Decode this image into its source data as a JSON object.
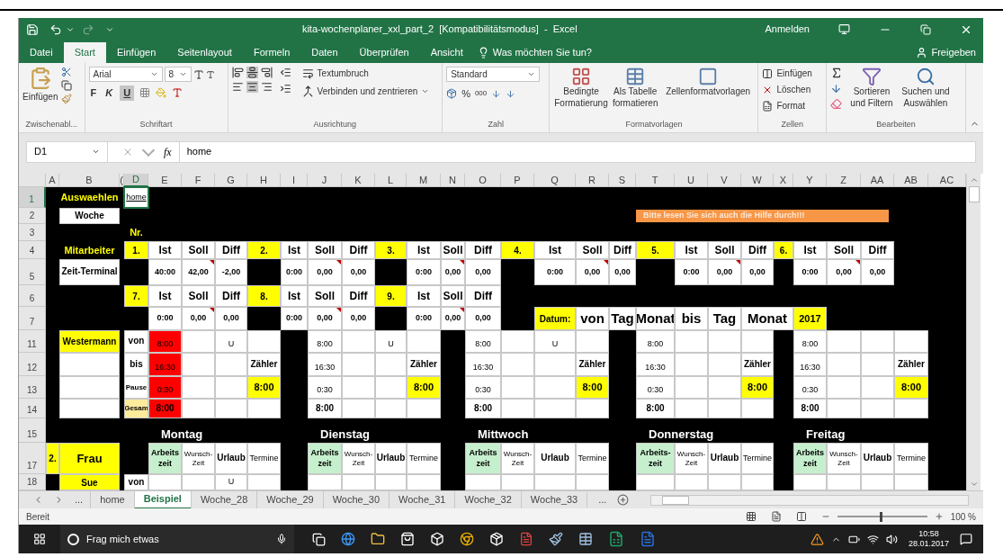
{
  "window": {
    "title": "kita-wochenplaner_xxl_part_2  [Kompatibilitätsmodus]  -  Excel",
    "account": "Anmelden"
  },
  "menu_tabs": [
    {
      "label": "Datei",
      "selected": false
    },
    {
      "label": "Start",
      "selected": true
    },
    {
      "label": "Einfügen",
      "selected": false
    },
    {
      "label": "Seitenlayout",
      "selected": false
    },
    {
      "label": "Formeln",
      "selected": false
    },
    {
      "label": "Daten",
      "selected": false
    },
    {
      "label": "Überprüfen",
      "selected": false
    },
    {
      "label": "Ansicht",
      "selected": false
    }
  ],
  "tell_me": "Was möchten Sie tun?",
  "share": "Freigeben",
  "ribbon": {
    "clipboard": {
      "label": "Zwischenabl...",
      "paste": "Einfügen"
    },
    "font": {
      "label": "Schriftart",
      "family": "Arial",
      "size": "8",
      "bold": "F",
      "italic": "K",
      "underline": {
        "label": "U",
        "on": true
      }
    },
    "alignment": {
      "label": "Ausrichtung",
      "middle_on": true,
      "center_on": true,
      "wrap": "Textumbruch",
      "merge": "Verbinden und zentrieren"
    },
    "number": {
      "label": "Zahl",
      "format": "Standard",
      "percent": "%",
      "thousands": "000"
    },
    "styles": {
      "label": "Formatvorlagen",
      "conditional": "Bedingte Formatierung",
      "table": "Als Tabelle formatieren",
      "cell_styles": "Zellenformatvorlagen"
    },
    "cells": {
      "label": "Zellen",
      "insert": "Einfügen",
      "delete": "Löschen",
      "format": "Format"
    },
    "editing": {
      "label": "Bearbeiten",
      "sort": "Sortieren und Filtern",
      "find": "Suchen und Auswählen"
    }
  },
  "formula_bar": {
    "name_box": "D1",
    "fx": "fx",
    "value": "home"
  },
  "sheet": {
    "columns": [
      {
        "label": "A",
        "selected": false
      },
      {
        "label": "B",
        "selected": false
      },
      {
        "label": "(",
        "selected": false
      },
      {
        "label": "D",
        "selected": true
      },
      {
        "label": "E",
        "selected": false
      },
      {
        "label": "F",
        "selected": false
      },
      {
        "label": "G",
        "selected": false
      },
      {
        "label": "H",
        "selected": false
      },
      {
        "label": "I",
        "selected": false
      },
      {
        "label": "J",
        "selected": false
      },
      {
        "label": "K",
        "selected": false
      },
      {
        "label": "L",
        "selected": false
      },
      {
        "label": "M",
        "selected": false
      },
      {
        "label": "N",
        "selected": false
      },
      {
        "label": "O",
        "selected": false
      },
      {
        "label": "P",
        "selected": false
      },
      {
        "label": "Q",
        "selected": false
      },
      {
        "label": "R",
        "selected": false
      },
      {
        "label": "S",
        "selected": false
      },
      {
        "label": "T",
        "selected": false
      },
      {
        "label": "U",
        "selected": false
      },
      {
        "label": "V",
        "selected": false
      },
      {
        "label": "W",
        "selected": false
      },
      {
        "label": "X",
        "selected": false
      },
      {
        "label": "Y",
        "selected": false
      },
      {
        "label": "Z",
        "selected": false
      },
      {
        "label": "AA",
        "selected": false
      },
      {
        "label": "AB",
        "selected": false
      },
      {
        "label": "AC",
        "selected": false
      }
    ],
    "rows": [
      {
        "label": "1",
        "selected": true,
        "cells": [
          null,
          {
            "text": "Auswaehlen",
            "kind": "title"
          },
          null,
          {
            "text": "home",
            "kind": "link",
            "color": "#ffffff"
          }
        ]
      },
      {
        "label": "2",
        "selected": false,
        "cells": [
          null,
          {
            "text": "Woche",
            "kind": "bold",
            "color": "#ffffff"
          },
          null,
          null,
          null,
          null,
          null,
          null,
          null,
          null,
          null,
          null,
          null,
          null,
          null,
          null,
          null,
          null,
          null,
          {
            "text": "Bitte lesen Sie sich auch die Hilfe durch!!!",
            "kind": "banner",
            "color": "#f79646"
          }
        ]
      },
      {
        "label": "3",
        "selected": false,
        "cells": [
          null,
          null,
          null,
          {
            "text": "Nr.",
            "kind": "title"
          }
        ]
      },
      {
        "label": "4",
        "selected": false,
        "cells": [
          null,
          {
            "text": "Mitarbeiter",
            "kind": "title"
          },
          null,
          {
            "text": "1.",
            "kind": "marker",
            "color": "#ffff00"
          },
          {
            "text": "Ist",
            "kind": "head",
            "color": "#ffffff"
          },
          {
            "text": "Soll",
            "kind": "head",
            "color": "#ffffff"
          },
          {
            "text": "Diff",
            "kind": "head",
            "color": "#ffffff"
          },
          {
            "text": "2.",
            "kind": "marker",
            "color": "#ffff00"
          },
          {
            "text": "Ist",
            "kind": "head",
            "color": "#ffffff"
          },
          {
            "text": "Soll",
            "kind": "head",
            "color": "#ffffff"
          },
          {
            "text": "Diff",
            "kind": "head",
            "color": "#ffffff"
          },
          {
            "text": "3.",
            "kind": "marker",
            "color": "#ffff00"
          },
          {
            "text": "Ist",
            "kind": "head",
            "color": "#ffffff"
          },
          {
            "text": "Soll",
            "kind": "head",
            "color": "#ffffff"
          },
          {
            "text": "Diff",
            "kind": "head",
            "color": "#ffffff"
          },
          {
            "text": "4.",
            "kind": "marker",
            "color": "#ffff00"
          },
          {
            "text": "Ist",
            "kind": "head",
            "color": "#ffffff"
          },
          {
            "text": "Soll",
            "kind": "head",
            "color": "#ffffff"
          },
          {
            "text": "Diff",
            "kind": "head",
            "color": "#ffffff"
          },
          {
            "text": "5.",
            "kind": "marker",
            "color": "#ffff00"
          },
          {
            "text": "Ist",
            "kind": "head",
            "color": "#ffffff"
          },
          {
            "text": "Soll",
            "kind": "head",
            "color": "#ffffff"
          },
          {
            "text": "Diff",
            "kind": "head",
            "color": "#ffffff"
          },
          {
            "text": "6.",
            "kind": "marker",
            "color": "#ffff00"
          },
          {
            "text": "Ist",
            "kind": "head",
            "color": "#ffffff"
          },
          {
            "text": "Soll",
            "kind": "head",
            "color": "#ffffff"
          },
          {
            "text": "Diff",
            "kind": "head",
            "color": "#ffffff"
          }
        ]
      },
      {
        "label": "5",
        "selected": false,
        "cells": [
          null,
          {
            "text": "Zeit-Terminal",
            "kind": "bold",
            "color": "#ffffff"
          },
          null,
          null,
          {
            "text": "40:00",
            "kind": "value",
            "color": "#ffffff"
          },
          {
            "text": "42,00",
            "kind": "note",
            "color": "#ffffff"
          },
          {
            "text": "-2,00",
            "kind": "value",
            "color": "#ffffff"
          },
          null,
          {
            "text": "0:00",
            "kind": "value",
            "color": "#ffffff"
          },
          {
            "text": "0,00",
            "kind": "note",
            "color": "#ffffff"
          },
          {
            "text": "0,00",
            "kind": "value",
            "color": "#ffffff"
          },
          null,
          {
            "text": "0:00",
            "kind": "value",
            "color": "#ffffff"
          },
          {
            "text": "0,00",
            "kind": "note",
            "color": "#ffffff"
          },
          {
            "text": "0,00",
            "kind": "value",
            "color": "#ffffff"
          },
          null,
          {
            "text": "0:00",
            "kind": "value",
            "color": "#ffffff"
          },
          {
            "text": "0,00",
            "kind": "note",
            "color": "#ffffff"
          },
          {
            "text": "0,00",
            "kind": "value",
            "color": "#ffffff"
          },
          null,
          {
            "text": "0:00",
            "kind": "value",
            "color": "#ffffff"
          },
          {
            "text": "0,00",
            "kind": "note",
            "color": "#ffffff"
          },
          {
            "text": "0,00",
            "kind": "value",
            "color": "#ffffff"
          },
          null,
          {
            "text": "0:00",
            "kind": "value",
            "color": "#ffffff"
          },
          {
            "text": "0,00",
            "kind": "note",
            "color": "#ffffff"
          },
          {
            "text": "0,00",
            "kind": "value",
            "color": "#ffffff"
          }
        ]
      },
      {
        "label": "6",
        "selected": false,
        "cells": [
          null,
          null,
          null,
          {
            "text": "7.",
            "kind": "marker",
            "color": "#ffff00"
          },
          {
            "text": "Ist",
            "kind": "head",
            "color": "#ffffff"
          },
          {
            "text": "Soll",
            "kind": "head",
            "color": "#ffffff"
          },
          {
            "text": "Diff",
            "kind": "head",
            "color": "#ffffff"
          },
          {
            "text": "8.",
            "kind": "marker",
            "color": "#ffff00"
          },
          {
            "text": "Ist",
            "kind": "head",
            "color": "#ffffff"
          },
          {
            "text": "Soll",
            "kind": "head",
            "color": "#ffffff"
          },
          {
            "text": "Diff",
            "kind": "head",
            "color": "#ffffff"
          },
          {
            "text": "9.",
            "kind": "marker",
            "color": "#ffff00"
          },
          {
            "text": "Ist",
            "kind": "head",
            "color": "#ffffff"
          },
          {
            "text": "Soll",
            "kind": "head",
            "color": "#ffffff"
          },
          {
            "text": "Diff",
            "kind": "head",
            "color": "#ffffff"
          }
        ]
      },
      {
        "label": "7",
        "selected": false,
        "cells": [
          null,
          null,
          null,
          null,
          {
            "text": "0:00",
            "kind": "value",
            "color": "#ffffff"
          },
          {
            "text": "0,00",
            "kind": "note",
            "color": "#ffffff"
          },
          {
            "text": "0,00",
            "kind": "value",
            "color": "#ffffff"
          },
          null,
          {
            "text": "0:00",
            "kind": "value",
            "color": "#ffffff"
          },
          {
            "text": "0,00",
            "kind": "note",
            "color": "#ffffff"
          },
          {
            "text": "0,00",
            "kind": "value",
            "color": "#ffffff"
          },
          null,
          {
            "text": "0:00",
            "kind": "value",
            "color": "#ffffff"
          },
          {
            "text": "0,00",
            "kind": "note",
            "color": "#ffffff"
          },
          {
            "text": "0,00",
            "kind": "value",
            "color": "#ffffff"
          },
          null,
          {
            "text": "Datum:",
            "kind": "marker",
            "color": "#ffff00"
          },
          {
            "text": "von",
            "kind": "big",
            "color": "#ffffff"
          },
          {
            "text": "Tag",
            "kind": "big",
            "color": "#ffffff"
          },
          {
            "text": "Monat",
            "kind": "big",
            "color": "#ffffff"
          },
          {
            "text": "bis",
            "kind": "big",
            "color": "#ffffff"
          },
          {
            "text": "Tag",
            "kind": "big",
            "color": "#ffffff"
          },
          {
            "text": "Monat",
            "kind": "big-wide",
            "color": "#ffffff"
          },
          null,
          {
            "text": "2017",
            "kind": "year",
            "color": "#ffff00"
          }
        ]
      },
      {
        "label": "11",
        "selected": false,
        "cells": [
          null,
          {
            "text": "Westermann",
            "kind": "marker",
            "color": "#ffff00"
          },
          null,
          {
            "text": "von",
            "kind": "bold",
            "color": "#ffffff"
          },
          {
            "text": "8:00",
            "kind": "time",
            "color": "#ff0000"
          },
          {
            "color": "#ffffff"
          },
          {
            "text": "U",
            "kind": "time",
            "color": "#ffffff"
          },
          {
            "color": "#ffffff"
          },
          null,
          {
            "text": "8:00",
            "kind": "time",
            "color": "#ffffff"
          },
          {
            "color": "#ffffff"
          },
          {
            "text": "U",
            "kind": "time",
            "color": "#ffffff"
          },
          {
            "color": "#ffffff"
          },
          null,
          {
            "text": "8:00",
            "kind": "time",
            "color": "#ffffff"
          },
          {
            "color": "#ffffff"
          },
          {
            "text": "U",
            "kind": "time",
            "color": "#ffffff"
          },
          {
            "color": "#ffffff"
          },
          null,
          {
            "text": "8:00",
            "kind": "time",
            "color": "#ffffff"
          },
          {
            "color": "#ffffff"
          },
          {
            "color": "#ffffff"
          },
          {
            "color": "#ffffff"
          },
          null,
          {
            "text": "8:00",
            "kind": "time",
            "color": "#ffffff"
          },
          {
            "color": "#ffffff"
          },
          {
            "color": "#ffffff"
          },
          {
            "color": "#ffffff"
          }
        ]
      },
      {
        "label": "12",
        "selected": false,
        "cells": [
          null,
          {
            "color": "#ffffff"
          },
          null,
          {
            "text": "bis",
            "kind": "bold",
            "color": "#ffffff"
          },
          {
            "text": "16:30",
            "kind": "time",
            "color": "#ff0000"
          },
          {
            "color": "#ffffff"
          },
          {
            "color": "#ffffff"
          },
          {
            "text": "Zähler",
            "kind": "bold",
            "color": "#ffffff"
          },
          null,
          {
            "text": "16:30",
            "kind": "time",
            "color": "#ffffff"
          },
          {
            "color": "#ffffff"
          },
          {
            "color": "#ffffff"
          },
          {
            "text": "Zähler",
            "kind": "bold",
            "color": "#ffffff"
          },
          null,
          {
            "text": "16:30",
            "kind": "time",
            "color": "#ffffff"
          },
          {
            "color": "#ffffff"
          },
          {
            "color": "#ffffff"
          },
          {
            "text": "Zähler",
            "kind": "bold",
            "color": "#ffffff"
          },
          null,
          {
            "text": "16:30",
            "kind": "time",
            "color": "#ffffff"
          },
          {
            "color": "#ffffff"
          },
          {
            "color": "#ffffff"
          },
          {
            "text": "Zähler",
            "kind": "bold",
            "color": "#ffffff"
          },
          null,
          {
            "text": "16:30",
            "kind": "time",
            "color": "#ffffff"
          },
          {
            "color": "#ffffff"
          },
          {
            "color": "#ffffff"
          },
          {
            "text": "Zähler",
            "kind": "bold",
            "color": "#ffffff"
          }
        ]
      },
      {
        "label": "13",
        "selected": false,
        "cells": [
          null,
          {
            "color": "#ffffff"
          },
          null,
          {
            "text": "Pause",
            "kind": "narrow",
            "color": "#ffffff"
          },
          {
            "text": "0:30",
            "kind": "time",
            "color": "#ff0000"
          },
          {
            "color": "#ffffff"
          },
          {
            "color": "#ffffff"
          },
          {
            "text": "8:00",
            "kind": "total",
            "color": "#ffff00"
          },
          null,
          {
            "text": "0:30",
            "kind": "time",
            "color": "#ffffff"
          },
          {
            "color": "#ffffff"
          },
          {
            "color": "#ffffff"
          },
          {
            "text": "8:00",
            "kind": "total",
            "color": "#ffff00"
          },
          null,
          {
            "text": "0:30",
            "kind": "time",
            "color": "#ffffff"
          },
          {
            "color": "#ffffff"
          },
          {
            "color": "#ffffff"
          },
          {
            "text": "8:00",
            "kind": "total",
            "color": "#ffff00"
          },
          null,
          {
            "text": "0:30",
            "kind": "time",
            "color": "#ffffff"
          },
          {
            "color": "#ffffff"
          },
          {
            "color": "#ffffff"
          },
          {
            "text": "8:00",
            "kind": "total",
            "color": "#ffff00"
          },
          null,
          {
            "text": "0:30",
            "kind": "time",
            "color": "#ffffff"
          },
          {
            "color": "#ffffff"
          },
          {
            "color": "#ffffff"
          },
          {
            "text": "8:00",
            "kind": "total",
            "color": "#ffff00"
          }
        ]
      },
      {
        "label": "14",
        "selected": false,
        "cells": [
          null,
          {
            "color": "#ffffff"
          },
          null,
          {
            "text": "Gesam",
            "kind": "narrow",
            "color": "#ffeb9c"
          },
          {
            "text": "8:00",
            "kind": "bold",
            "color": "#ff0000"
          },
          {
            "color": "#ffffff"
          },
          {
            "color": "#ffffff"
          },
          {
            "color": "#ffffff"
          },
          null,
          {
            "text": "8:00",
            "kind": "bold",
            "color": "#ffffff"
          },
          {
            "color": "#ffffff"
          },
          {
            "color": "#ffffff"
          },
          {
            "color": "#ffffff"
          },
          null,
          {
            "text": "8:00",
            "kind": "bold",
            "color": "#ffffff"
          },
          {
            "color": "#ffffff"
          },
          {
            "color": "#ffffff"
          },
          {
            "color": "#ffffff"
          },
          null,
          {
            "text": "8:00",
            "kind": "bold",
            "color": "#ffffff"
          },
          {
            "color": "#ffffff"
          },
          {
            "color": "#ffffff"
          },
          {
            "color": "#ffffff"
          },
          null,
          {
            "text": "8:00",
            "kind": "bold",
            "color": "#ffffff"
          },
          {
            "color": "#ffffff"
          },
          {
            "color": "#ffffff"
          },
          {
            "color": "#ffffff"
          }
        ]
      },
      {
        "label": "15",
        "selected": false,
        "cells": [
          null,
          null,
          null,
          null,
          {
            "text": "Montag",
            "kind": "day"
          },
          null,
          null,
          null,
          null,
          {
            "text": "Dienstag",
            "kind": "day"
          },
          null,
          null,
          null,
          null,
          {
            "text": "Mittwoch",
            "kind": "day"
          },
          null,
          null,
          null,
          null,
          {
            "text": "Donnerstag",
            "kind": "day"
          },
          null,
          null,
          null,
          null,
          {
            "text": "Freitag",
            "kind": "day"
          }
        ]
      },
      {
        "label": "17",
        "selected": false,
        "cells": [
          {
            "text": "2.",
            "kind": "marker",
            "color": "#ffff00"
          },
          {
            "text": "Frau",
            "kind": "name",
            "color": "#ffff00"
          },
          null,
          null,
          {
            "text": "Arbeits zeit",
            "kind": "colhead",
            "color": "#c6efce"
          },
          {
            "text": "Wunsch-Zeit",
            "kind": "small",
            "color": "#ffffff"
          },
          {
            "text": "Urlaub",
            "kind": "bold",
            "color": "#ffffff"
          },
          {
            "text": "Termine",
            "kind": "plain",
            "color": "#ffffff"
          },
          null,
          {
            "text": "Arbeits zeit",
            "kind": "colhead",
            "color": "#c6efce"
          },
          {
            "text": "Wunsch-Zeit",
            "kind": "small",
            "color": "#ffffff"
          },
          {
            "text": "Urlaub",
            "kind": "bold",
            "color": "#ffffff"
          },
          {
            "text": "Termine",
            "kind": "plain",
            "color": "#ffffff"
          },
          null,
          {
            "text": "Arbeits zeit",
            "kind": "colhead",
            "color": "#c6efce"
          },
          {
            "text": "Wunsch-Zeit",
            "kind": "small",
            "color": "#ffffff"
          },
          {
            "text": "Urlaub",
            "kind": "bold",
            "color": "#ffffff"
          },
          {
            "text": "Termine",
            "kind": "plain",
            "color": "#ffffff"
          },
          null,
          {
            "text": "Arbeits-zeit",
            "kind": "colhead",
            "color": "#c6efce"
          },
          {
            "text": "Wunsch-Zeit",
            "kind": "small",
            "color": "#ffffff"
          },
          {
            "text": "Urlaub",
            "kind": "bold",
            "color": "#ffffff"
          },
          {
            "text": "Termine",
            "kind": "plain",
            "color": "#ffffff"
          },
          null,
          {
            "text": "Arbeits zeit",
            "kind": "colhead",
            "color": "#c6efce"
          },
          {
            "text": "Wunsch-Zeit",
            "kind": "small",
            "color": "#ffffff"
          },
          {
            "text": "Urlaub",
            "kind": "bold",
            "color": "#ffffff"
          },
          {
            "text": "Termine",
            "kind": "plain",
            "color": "#ffffff"
          }
        ]
      },
      {
        "label": "18",
        "selected": false,
        "cells": [
          null,
          {
            "text": "Sue",
            "kind": "marker",
            "color": "#ffff00"
          },
          null,
          {
            "text": "von",
            "kind": "bold",
            "color": "#ffffff"
          },
          {
            "color": "#ffffff"
          },
          {
            "color": "#ffffff"
          },
          {
            "text": "U",
            "kind": "time",
            "color": "#ffffff"
          },
          {
            "color": "#ffffff"
          },
          null,
          {
            "color": "#ffffff"
          },
          {
            "color": "#ffffff"
          },
          {
            "color": "#ffffff"
          },
          {
            "color": "#ffffff"
          },
          null,
          {
            "color": "#ffffff"
          },
          {
            "color": "#ffffff"
          },
          {
            "color": "#ffffff"
          },
          {
            "color": "#ffffff"
          },
          null,
          {
            "color": "#ffffff"
          },
          {
            "color": "#ffffff"
          },
          {
            "color": "#ffffff"
          },
          {
            "color": "#ffffff"
          },
          null,
          {
            "color": "#ffffff"
          },
          {
            "color": "#ffffff"
          },
          {
            "color": "#ffffff"
          },
          {
            "color": "#ffffff"
          }
        ]
      }
    ]
  },
  "sheet_tabs": {
    "more_left": "...",
    "tabs": [
      {
        "label": "home",
        "selected": false
      },
      {
        "label": "Beispiel",
        "selected": true
      },
      {
        "label": "Woche_28",
        "selected": false
      },
      {
        "label": "Woche_29",
        "selected": false
      },
      {
        "label": "Woche_30",
        "selected": false
      },
      {
        "label": "Woche_31",
        "selected": false
      },
      {
        "label": "Woche_32",
        "selected": false
      },
      {
        "label": "Woche_33",
        "selected": false
      }
    ],
    "more_right": "..."
  },
  "status_bar": {
    "status": "Bereit",
    "zoom": "100 %",
    "zoom_slider": {
      "level": 0.5
    }
  },
  "taskbar": {
    "search": "Frag mich etwas",
    "time": "10:58",
    "date": "28.01.2017"
  }
}
